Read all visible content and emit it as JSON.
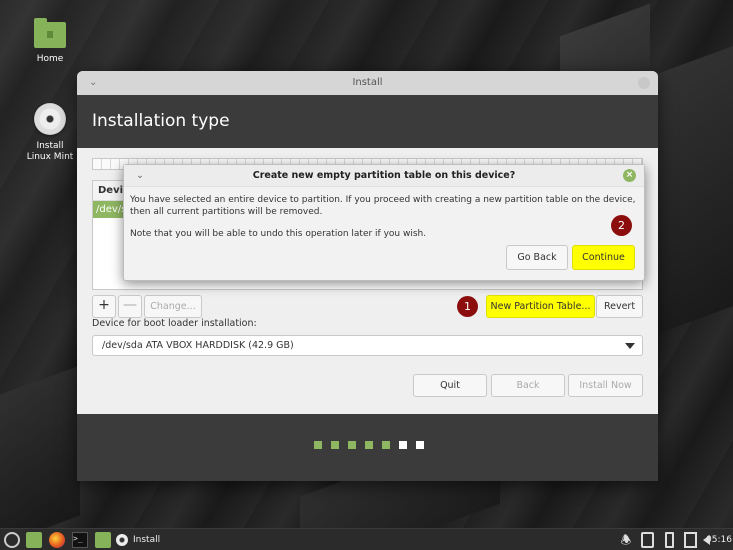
{
  "desktop": {
    "icons": [
      {
        "label": "Home",
        "icon": "folder-home-icon"
      },
      {
        "label": "Install Linux Mint",
        "icon": "disc-icon"
      }
    ]
  },
  "window": {
    "title": "Install",
    "header": "Installation type",
    "table_header": "Devic",
    "table_row": "/dev/s",
    "add_label": "+",
    "remove_label": "—",
    "change_label": "Change...",
    "new_partition_table_label": "New Partition Table...",
    "revert_label": "Revert",
    "boot_loader_label": "Device for boot loader installation:",
    "boot_loader_value": "/dev/sda ATA VBOX HARDDISK (42.9 GB)",
    "quit_label": "Quit",
    "back_label": "Back",
    "install_now_label": "Install Now",
    "progress": {
      "completed_steps": 5,
      "total_steps": 7
    },
    "accent_color": "#8fb762"
  },
  "dialog": {
    "title": "Create new empty partition table on this device?",
    "message": "You have selected an entire device to partition. If you proceed with creating a new partition table on the device, then all current partitions will be removed.",
    "note": "Note that you will be able to undo this operation later if you wish.",
    "go_back_label": "Go Back",
    "continue_label": "Continue",
    "highlight_color": "#ffff00"
  },
  "markers": {
    "step1": "1",
    "step2": "2"
  },
  "taskbar": {
    "app_label": "Install",
    "clock": "05:16",
    "icons": [
      "mint-menu-icon",
      "show-desktop-icon",
      "firefox-icon",
      "terminal-icon",
      "files-icon",
      "installer-icon",
      "notifications-icon",
      "clipboard-icon",
      "battery-icon",
      "network-icon",
      "volume-icon"
    ]
  }
}
